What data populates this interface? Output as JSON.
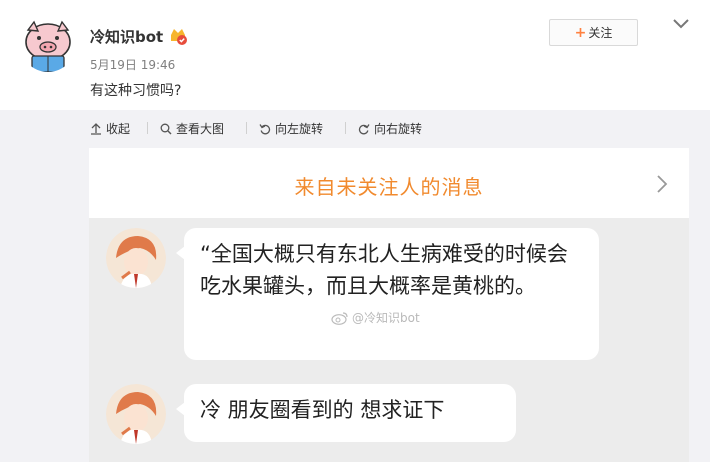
{
  "post": {
    "username": "冷知识bot",
    "time": "5月19日 19:46",
    "text": "有这种习惯吗?",
    "follow_label": "关注"
  },
  "toolbar": {
    "items": [
      {
        "label": "收起",
        "icon": "collapse-icon"
      },
      {
        "label": "查看大图",
        "icon": "zoom-icon"
      },
      {
        "label": "向左旋转",
        "icon": "rotate-left-icon"
      },
      {
        "label": "向右旋转",
        "icon": "rotate-right-icon"
      }
    ]
  },
  "image": {
    "banner_text": "来自未关注人的消息",
    "messages": [
      {
        "text": "“全国大概只有东北人生病难受的时候会吃水果罐头，而且大概率是黄桃的。"
      },
      {
        "text": "冷 朋友圈看到的 想求证下"
      }
    ],
    "watermark": "@冷知识bot"
  },
  "colors": {
    "accent_orange": "#f18a2e",
    "follow_plus": "#ff8140",
    "media_bg": "#f2f2f5"
  }
}
